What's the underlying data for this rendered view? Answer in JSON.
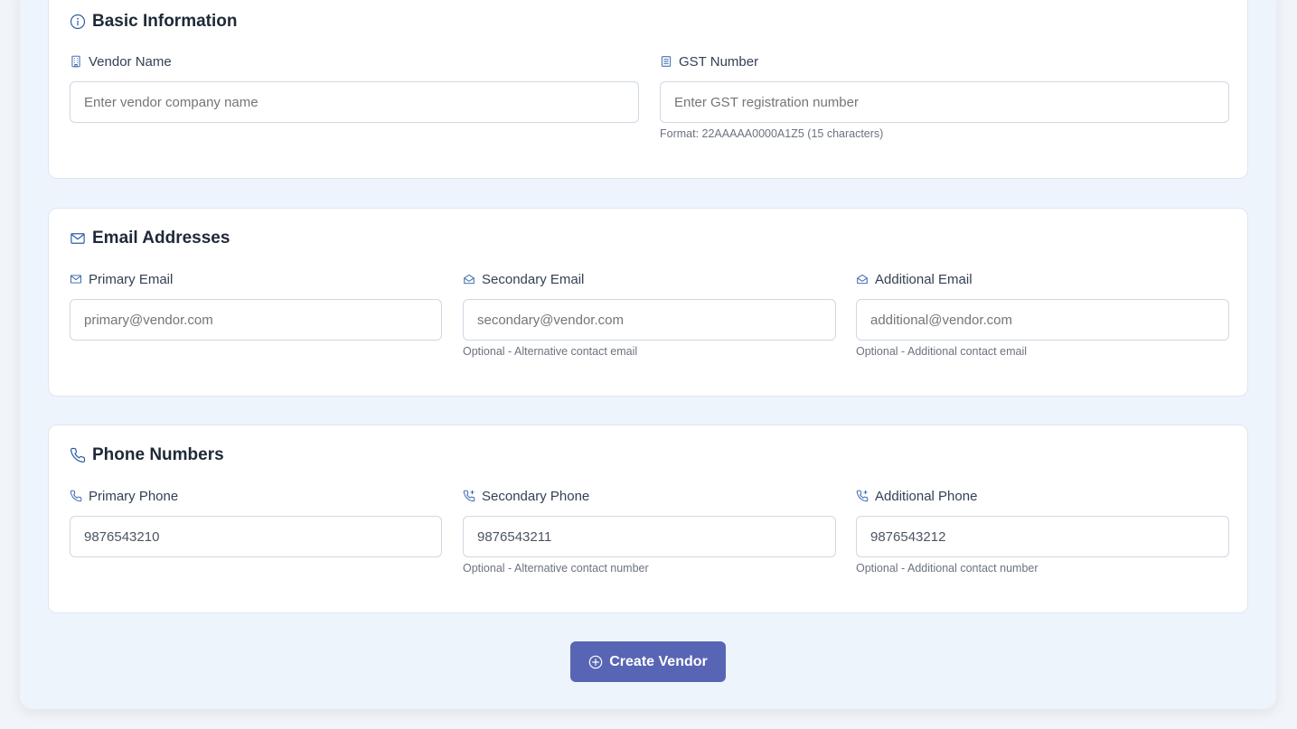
{
  "basic": {
    "title": "Basic Information",
    "vendor_name_label": "Vendor Name",
    "vendor_name_placeholder": "Enter vendor company name",
    "gst_label": "GST Number",
    "gst_placeholder": "Enter GST registration number",
    "gst_hint": "Format: 22AAAAA0000A1Z5 (15 characters)"
  },
  "emails": {
    "title": "Email Addresses",
    "primary_label": "Primary Email",
    "primary_placeholder": "primary@vendor.com",
    "secondary_label": "Secondary Email",
    "secondary_placeholder": "secondary@vendor.com",
    "secondary_hint": "Optional - Alternative contact email",
    "additional_label": "Additional Email",
    "additional_placeholder": "additional@vendor.com",
    "additional_hint": "Optional - Additional contact email"
  },
  "phones": {
    "title": "Phone Numbers",
    "primary_label": "Primary Phone",
    "primary_value": "9876543210",
    "secondary_label": "Secondary Phone",
    "secondary_value": "9876543211",
    "secondary_hint": "Optional - Alternative contact number",
    "additional_label": "Additional Phone",
    "additional_value": "9876543212",
    "additional_hint": "Optional - Additional contact number"
  },
  "actions": {
    "create_label": "Create Vendor"
  },
  "icons": {
    "info": "info-icon",
    "building": "building-icon",
    "document": "document-icon",
    "mail": "mail-icon",
    "mail_open": "mail-open-icon",
    "phone": "phone-icon",
    "phone_forward": "phone-forward-icon",
    "plus_circle": "plus-circle-icon"
  },
  "colors": {
    "accent": "#2b5ea8",
    "button": "#5865b5",
    "panel": "#edf4fc"
  }
}
